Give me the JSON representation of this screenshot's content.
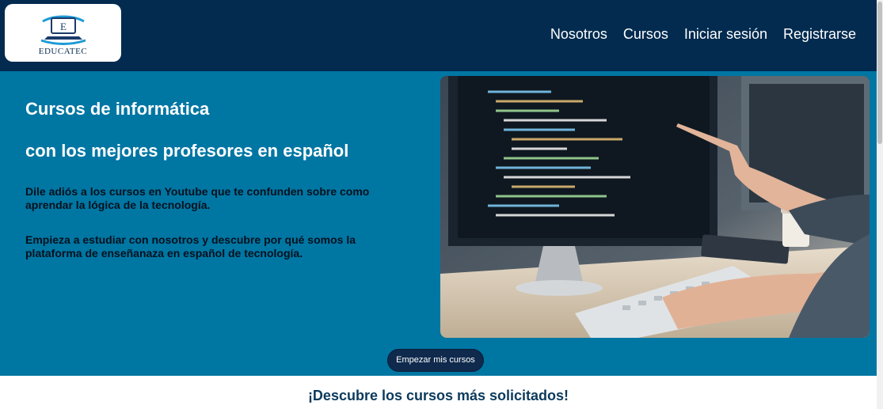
{
  "header": {
    "logo_text": "EDUCATEC",
    "logo_letter": "E",
    "nav": {
      "about": "Nosotros",
      "courses": "Cursos",
      "login": "Iniciar sesión",
      "register": "Registrarse"
    }
  },
  "hero": {
    "title_line1": "Cursos de informática",
    "title_line2": "con los mejores profesores en español",
    "paragraph1": "Dile adiós a los cursos en Youtube que te confunden sobre como aprendar la lógica de la tecnología.",
    "paragraph2": "Empieza a estudiar con nosotros y descubre por qué somos la plataforma de enseñanaza en español de tecnología.",
    "cta_label": "Empezar mis cursos"
  },
  "section": {
    "title": "¡Descubre los cursos más solicitados!"
  },
  "colors": {
    "header_bg": "#022b4f",
    "hero_bg": "#0076a3",
    "button_bg": "#0f2a4d",
    "section_title": "#0b3a5c"
  },
  "icons": {
    "logo": "laptop-logo-icon"
  }
}
